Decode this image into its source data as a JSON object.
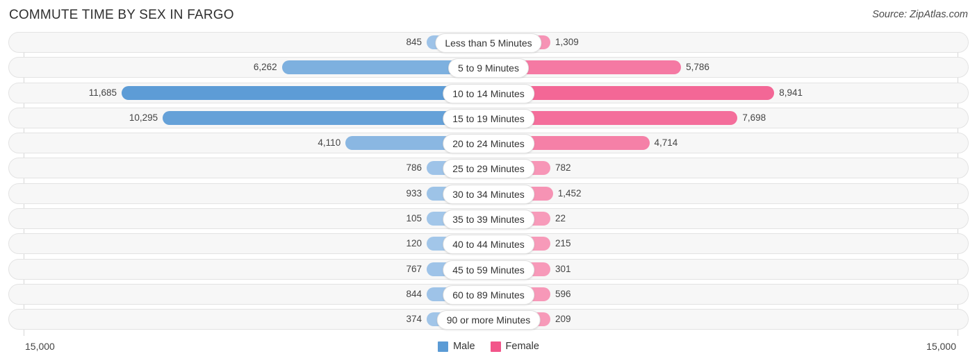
{
  "header": {
    "title": "COMMUTE TIME BY SEX IN FARGO",
    "source": "Source: ZipAtlas.com"
  },
  "legend": {
    "male_label": "Male",
    "female_label": "Female",
    "male_color": "#5b9bd5",
    "female_color": "#f2558a"
  },
  "axis": {
    "min_label": "15,000",
    "max_label": "15,000",
    "max_value": 15000
  },
  "chart_data": {
    "type": "bar",
    "orientation": "horizontal-diverging",
    "title": "COMMUTE TIME BY SEX IN FARGO",
    "xlabel": "",
    "ylabel": "",
    "xlim": [
      15000,
      15000
    ],
    "grid": false,
    "legend_position": "bottom-center",
    "categories": [
      "Less than 5 Minutes",
      "5 to 9 Minutes",
      "10 to 14 Minutes",
      "15 to 19 Minutes",
      "20 to 24 Minutes",
      "25 to 29 Minutes",
      "30 to 34 Minutes",
      "35 to 39 Minutes",
      "40 to 44 Minutes",
      "45 to 59 Minutes",
      "60 to 89 Minutes",
      "90 or more Minutes"
    ],
    "series": [
      {
        "name": "Male",
        "values": [
          845,
          6262,
          11685,
          10295,
          4110,
          786,
          933,
          105,
          120,
          767,
          844,
          374
        ],
        "labels": [
          "845",
          "6,262",
          "11,685",
          "10,295",
          "4,110",
          "786",
          "933",
          "105",
          "120",
          "767",
          "844",
          "374"
        ]
      },
      {
        "name": "Female",
        "values": [
          1309,
          5786,
          8941,
          7698,
          4714,
          782,
          1452,
          22,
          215,
          301,
          596,
          209
        ],
        "labels": [
          "1,309",
          "5,786",
          "8,941",
          "7,698",
          "4,714",
          "782",
          "1,452",
          "22",
          "215",
          "301",
          "596",
          "209"
        ]
      }
    ]
  }
}
